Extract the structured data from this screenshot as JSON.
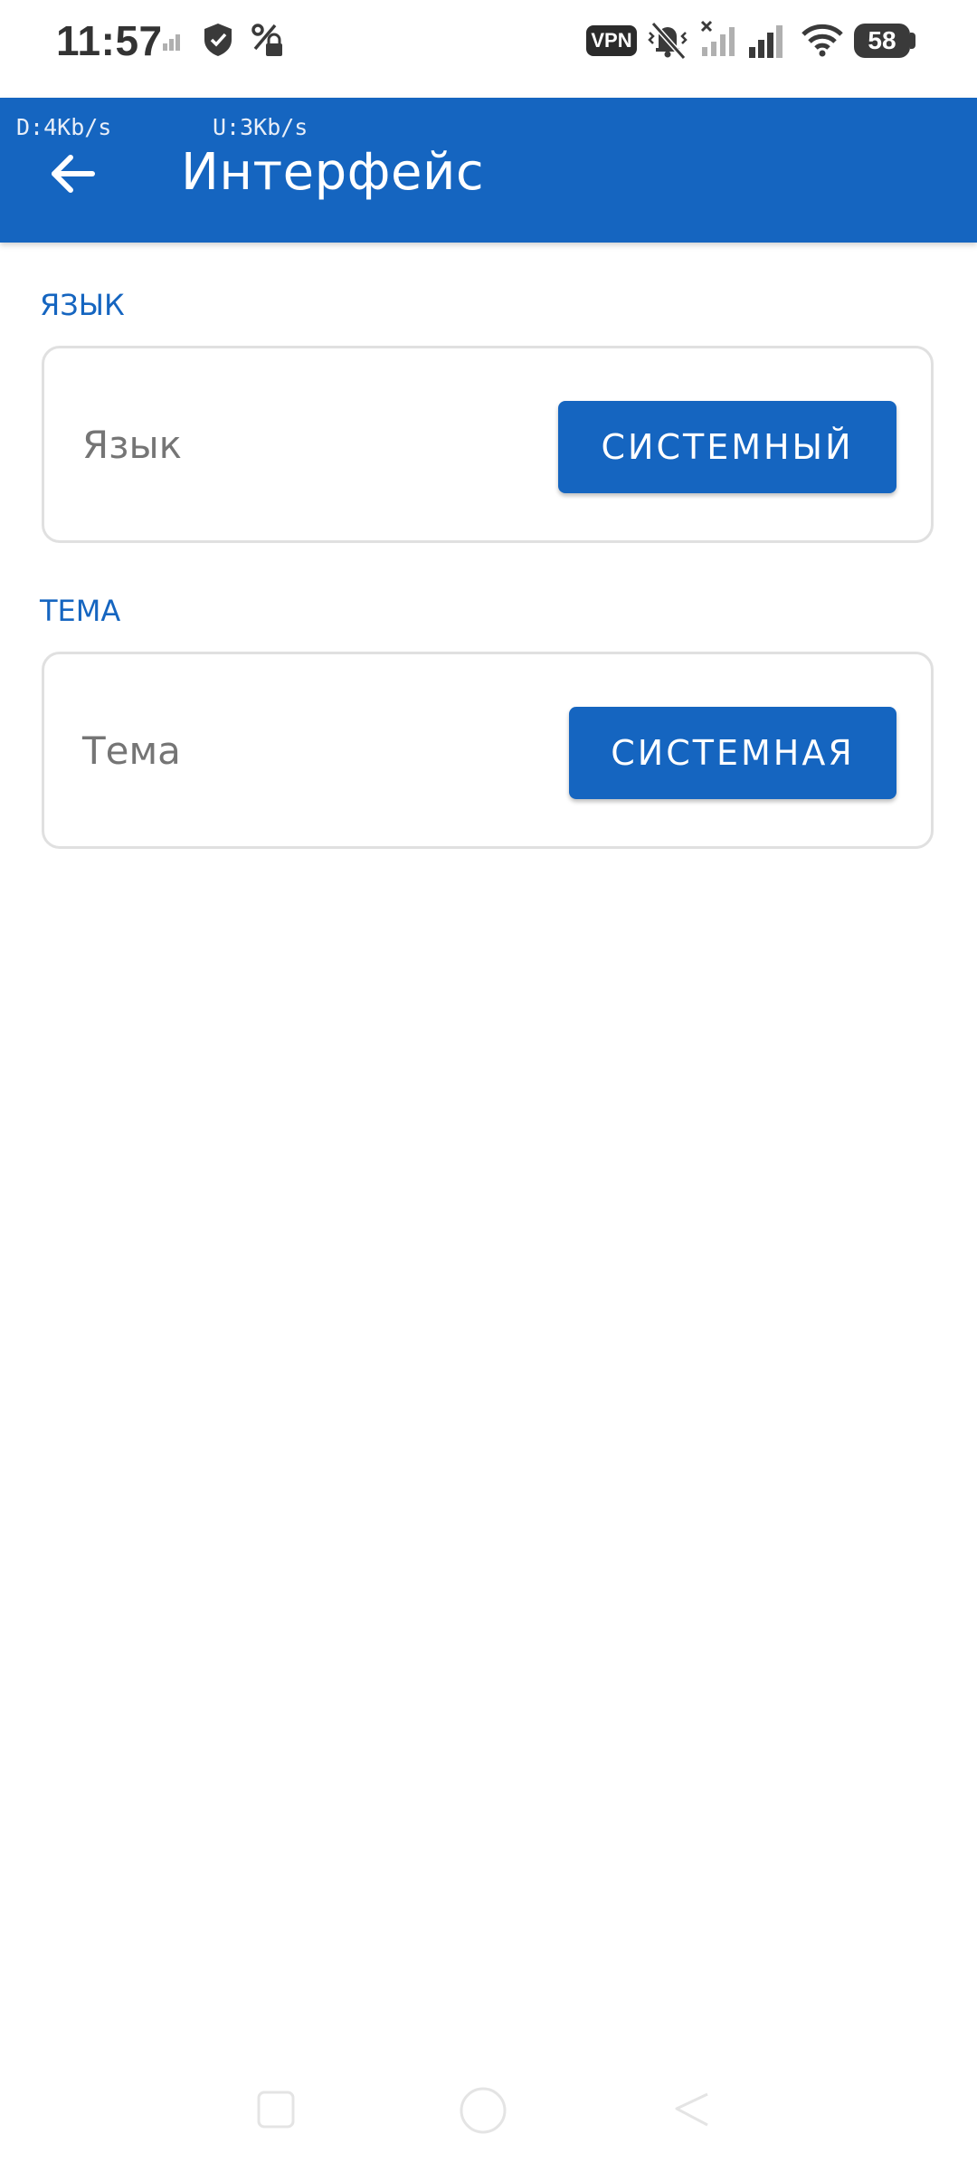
{
  "status_bar": {
    "time": "11:57",
    "vpn_label": "VPN",
    "battery_level": "58",
    "icons": [
      "signal-weak-icon",
      "shield-icon",
      "data-saver-icon",
      "vpn-icon",
      "vibrate-off-icon",
      "signal-no-sim-icon",
      "signal-icon",
      "wifi-icon",
      "battery-icon"
    ]
  },
  "app_bar": {
    "download_speed": "D:4Kb/s",
    "upload_speed": "U:3Kb/s",
    "title": "Интерфейс",
    "back_icon": "arrow-back-icon",
    "background_color": "#1565c0"
  },
  "sections": [
    {
      "header": "ЯЗЫК",
      "label": "Язык",
      "button_label": "СИСТЕМНЫЙ"
    },
    {
      "header": "ТЕМА",
      "label": "Тема",
      "button_label": "СИСТЕМНАЯ"
    }
  ],
  "nav_bar": {
    "icons": [
      "recents-icon",
      "home-icon",
      "back-icon"
    ]
  },
  "colors": {
    "accent": "#1565c0",
    "card_border": "#e0e0e0",
    "label_text": "#757575"
  }
}
